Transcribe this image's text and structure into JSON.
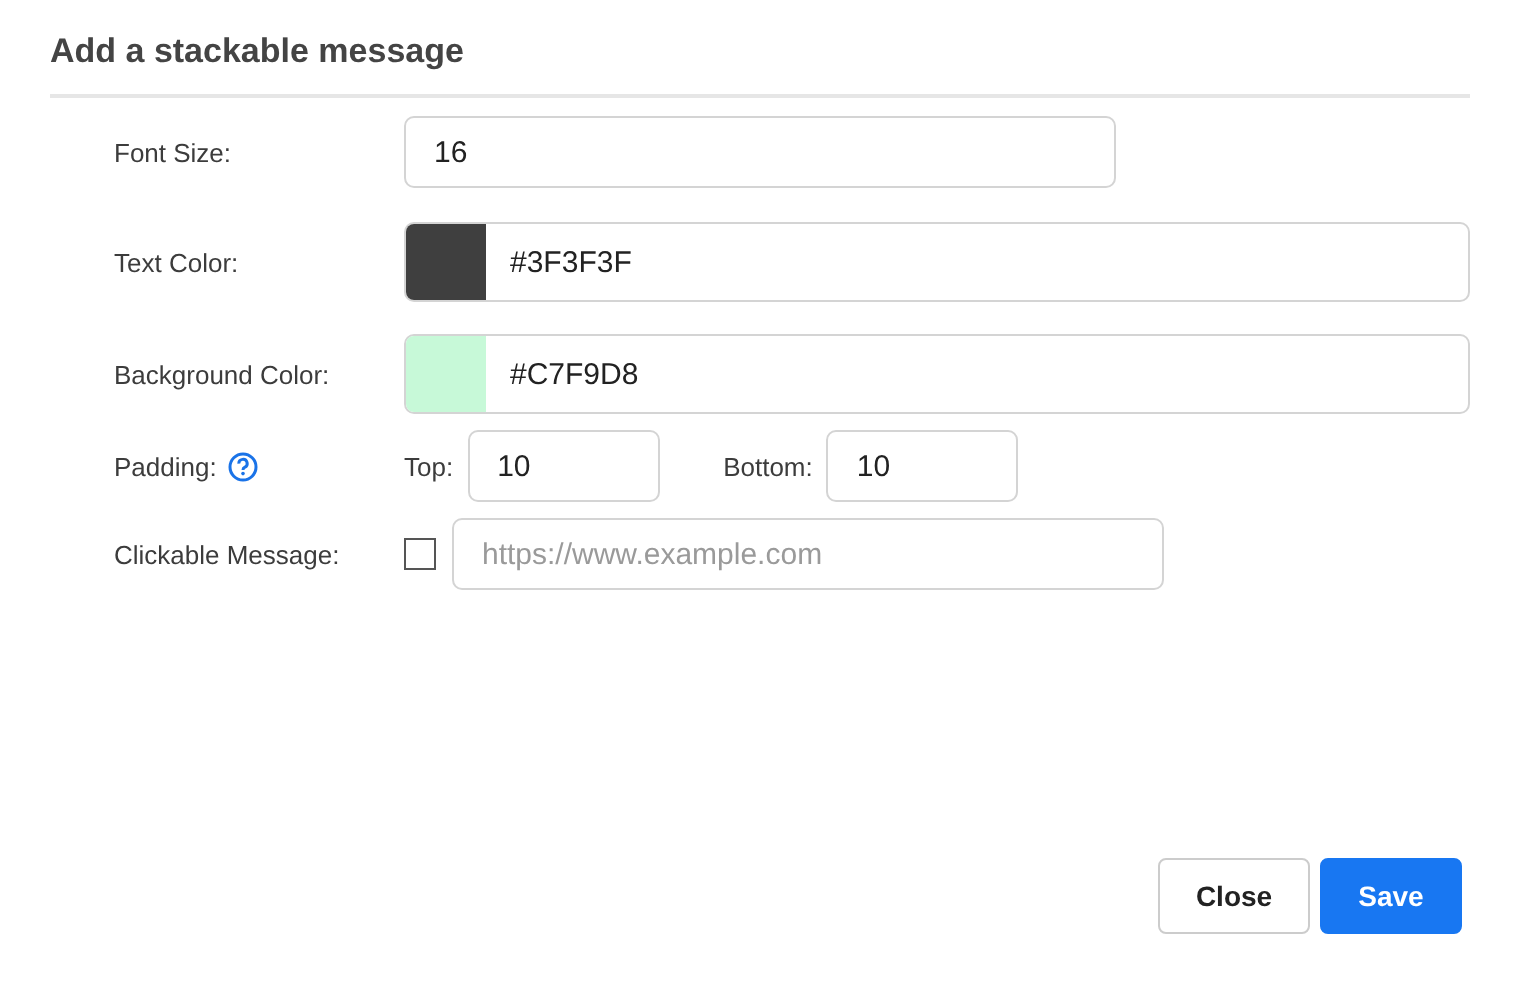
{
  "dialog": {
    "title": "Add a stackable message"
  },
  "font_size": {
    "label": "Font Size:",
    "value": "16"
  },
  "color_fields": [
    {
      "label": "Text Color:",
      "value": "#3F3F3F",
      "color": "#3f3f3f"
    },
    {
      "label": "Background Color:",
      "value": "#C7F9D8",
      "color": "#c7f9d8"
    }
  ],
  "padding": {
    "label": "Padding:",
    "top_label": "Top:",
    "top_value": "10",
    "bottom_label": "Bottom:",
    "bottom_value": "10"
  },
  "clickable": {
    "label": "Clickable Message:",
    "checked": false,
    "placeholder": "https://www.example.com"
  },
  "buttons": [
    {
      "label": "Close",
      "kind": "secondary"
    },
    {
      "label": "Save",
      "kind": "primary"
    }
  ]
}
